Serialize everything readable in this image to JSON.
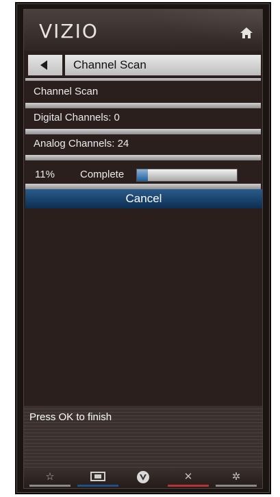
{
  "header": {
    "logo": "VIZIO",
    "home_icon": "home-icon"
  },
  "nav": {
    "back_icon": "left-triangle-icon",
    "title": "Channel Scan"
  },
  "rows": {
    "channel_scan": "Channel Scan",
    "digital_channels": "Digital Channels: 0",
    "analog_channels": "Analog Channels: 24"
  },
  "progress": {
    "percent_label": "11%",
    "complete_label": "Complete",
    "value": 0.11
  },
  "cancel_label": "Cancel",
  "info_text": "Press OK to finish",
  "bottom_bar": {
    "items": [
      {
        "icon": "star-icon",
        "line_color": "#8a8a8a"
      },
      {
        "icon": "input-icon",
        "line_color": "#1f4f86"
      },
      {
        "icon": "vizio-v-icon",
        "line_color": ""
      },
      {
        "icon": "close-icon",
        "line_color": "#b8323a"
      },
      {
        "icon": "gear-icon",
        "line_color": "#8a8a8a"
      }
    ]
  },
  "colors": {
    "accent_blue": "#1f5e9c",
    "red": "#b8323a"
  }
}
